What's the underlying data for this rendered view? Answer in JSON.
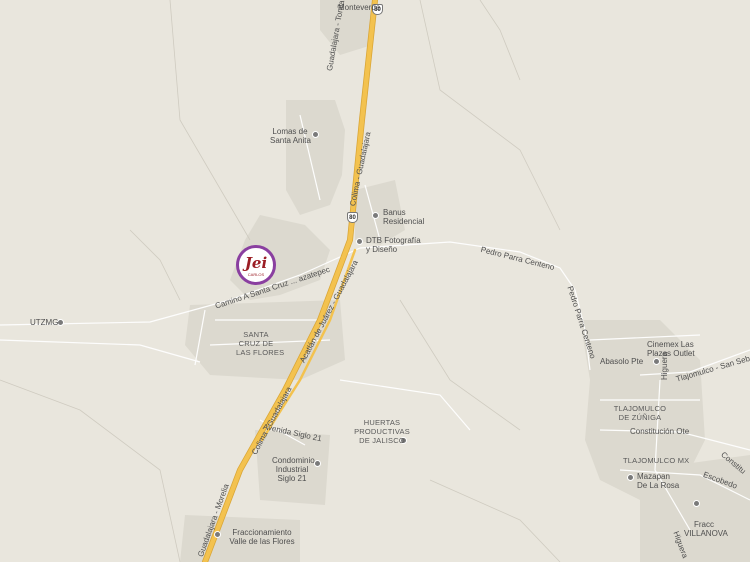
{
  "map": {
    "colors": {
      "background": "#e9e6dd",
      "urban": "#d9d6cc",
      "road": "#ffffff",
      "highway": "#f3c24f",
      "marker_ring": "#8a3fa0",
      "marker_logo": "#9b1d25"
    },
    "places": {
      "monteverde": "Monteverde",
      "lomas_de_santa_anita": "Lomas de\nSanta Anita",
      "banus_residencial": "Banus\nResidencial",
      "dtb": "DTB Fotografía\ny Diseño",
      "utzmg": "UTZMG",
      "santa_cruz": "SANTA\nCRUZ DE\nLAS FLORES",
      "huertas": "HUERTAS\nPRODUCTIVAS\nDE JALISCO",
      "condominio": "Condominio\nIndustrial\nSiglo 21",
      "fraccionamiento": "Fraccionamiento\nValle de las Flores",
      "cinemex": "Cinemex Las\nPlazas Outlet",
      "tlajomulco_zuniga": "TLAJOMULCO\nDE ZÚÑIGA",
      "tlajomulco_mx": "TLAJOMULCO MX",
      "mazapan": "Mazapan\nDe La Rosa",
      "fracc_villanova": "Fracc\nVILLANOVA"
    },
    "streets": {
      "guadalajara_tonila": "Guadalajara - Tonila",
      "colima_guadalajara": "Colima - Guadalajara",
      "acatlan_guadalajara": "Acatlán de Juárez - Guadalajara",
      "guadalajara_morelia": "Guadalajara - Morelia",
      "camino_santa_cruz": "Camino A Santa Cruz ... azatepec",
      "pedro_parra_centeno": "Pedro Parra Centeno",
      "avenida_siglo_21": "Avenida Siglo 21",
      "abasolo": "Abasolo Pte",
      "higuera": "Higuera",
      "constitucion": "Constitución Ote",
      "tlajomulco_san_sebastian": "Tlajomulco - San Sebastián",
      "constitucion_partial": "Constitu",
      "escobedo": "Escobedo"
    },
    "shields": {
      "top": "80",
      "middle": "80"
    },
    "marker": {
      "logo": "Jei",
      "sub": "CARLOS"
    }
  }
}
